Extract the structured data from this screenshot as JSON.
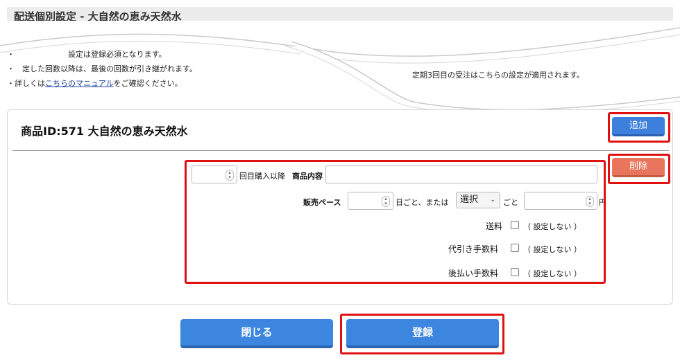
{
  "header": {
    "title": "配送個別設定 - 大自然の恵み天然水"
  },
  "notes": {
    "line1": "・　　　　　　　設定は登録必須となります。",
    "line2": "・　定した回数以降は、最後の回数が引き継がれます。",
    "line3_prefix": "・詳しくは",
    "line3_link": "こちらのマニュアル",
    "line3_suffix": "をご確認ください。",
    "right": "定期3回目の受注はこちらの設定が適用されます。"
  },
  "product": {
    "title": "商品ID:571 大自然の恵み天然水"
  },
  "buttons": {
    "add": "追加",
    "delete": "削除",
    "close": "閉じる",
    "register": "登録"
  },
  "form": {
    "purchase_count_suffix": "回目購入以降",
    "item_content_label": "商品内容",
    "pace_label": "販売ペース",
    "pace_days_suffix": "日ごと、または",
    "pace_select_value": "選択",
    "pace_every": "ごと",
    "yen": "円",
    "shipping_label": "送料",
    "cod_fee_label": "代引き手数料",
    "deferred_fee_label": "後払い手数料",
    "no_setting": "（ 設定しない ）"
  }
}
